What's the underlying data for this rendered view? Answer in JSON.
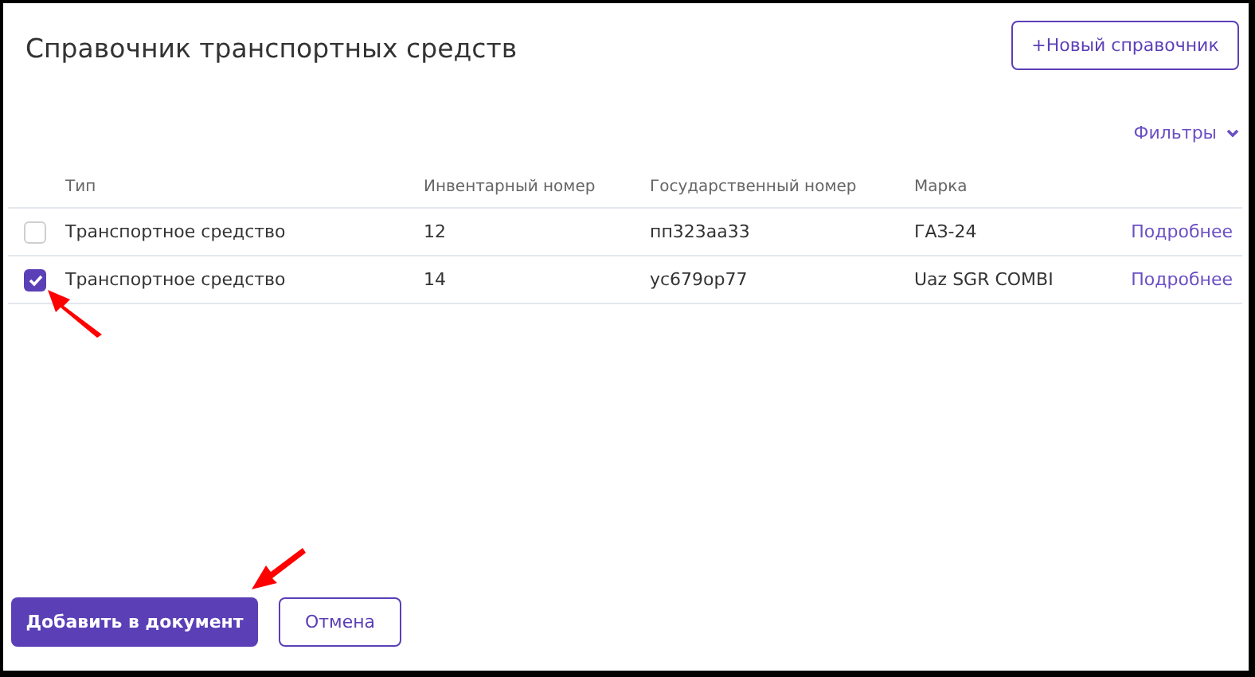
{
  "title": "Справочник транспортных средств",
  "new_button": "+Новый справочник",
  "filters": "Фильтры",
  "table": {
    "columns": [
      "Тип",
      "Инвентарный номер",
      "Государственный номер",
      "Марка"
    ],
    "rows": [
      {
        "selected": false,
        "cells": [
          "Транспортное средство",
          "12",
          "пп323аа33",
          "ГАЗ-24"
        ],
        "link": "Подробнее"
      },
      {
        "selected": true,
        "cells": [
          "Транспортное средство",
          "14",
          "ус679ор77",
          "Uaz SGR COMBI"
        ],
        "link": "Подробнее"
      }
    ]
  },
  "buttons": [
    {
      "kind": "primary",
      "label": "Добавить в документ"
    },
    {
      "kind": "secondary",
      "label": "Отмена"
    }
  ]
}
